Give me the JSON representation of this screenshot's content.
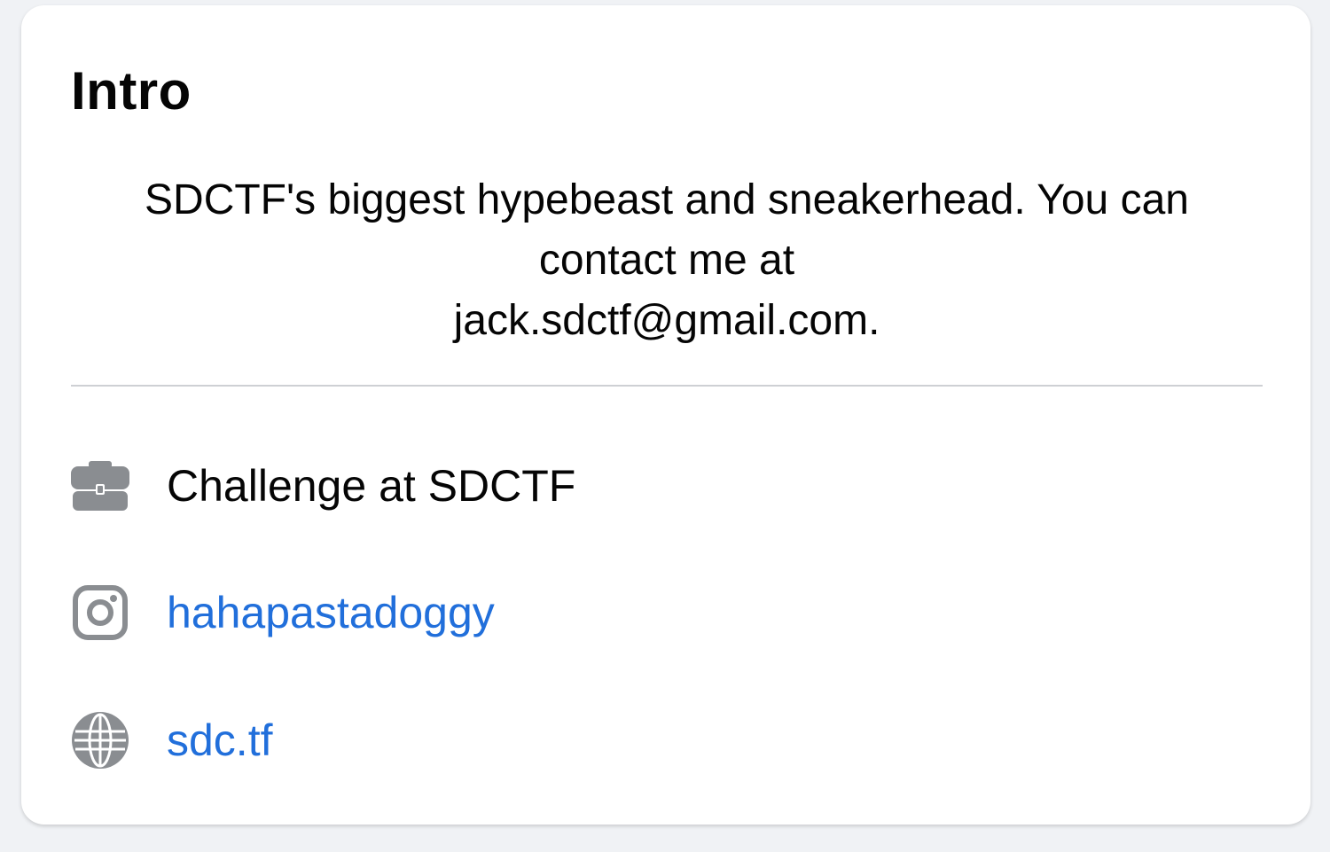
{
  "intro": {
    "title": "Intro",
    "bio_lines": [
      "SDCTF's biggest hypebeast and sneakerhead. You can",
      "contact me at",
      "jack.sdctf@gmail.com."
    ]
  },
  "details": {
    "work": {
      "icon": "briefcase-icon",
      "text": "Challenge at SDCTF"
    },
    "instagram": {
      "icon": "instagram-icon",
      "text": "hahapastadoggy"
    },
    "website": {
      "icon": "globe-icon",
      "text": "sdc.tf"
    }
  },
  "colors": {
    "background": "#f0f2f5",
    "card": "#ffffff",
    "text": "#050505",
    "link": "#216fdb",
    "icon": "#8a8d91",
    "divider": "#ced0d4"
  }
}
